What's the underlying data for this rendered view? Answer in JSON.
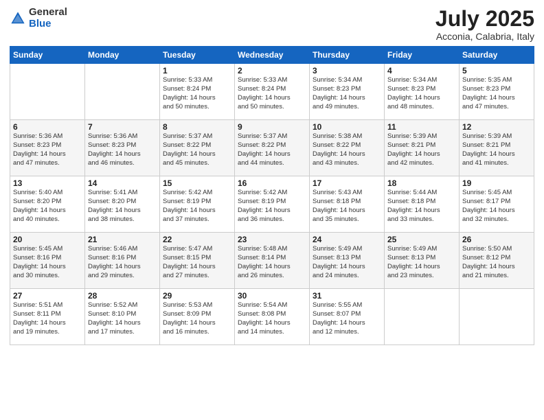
{
  "logo": {
    "general": "General",
    "blue": "Blue"
  },
  "header": {
    "month": "July 2025",
    "location": "Acconia, Calabria, Italy"
  },
  "weekdays": [
    "Sunday",
    "Monday",
    "Tuesday",
    "Wednesday",
    "Thursday",
    "Friday",
    "Saturday"
  ],
  "weeks": [
    [
      {
        "day": "",
        "info": ""
      },
      {
        "day": "",
        "info": ""
      },
      {
        "day": "1",
        "info": "Sunrise: 5:33 AM\nSunset: 8:24 PM\nDaylight: 14 hours\nand 50 minutes."
      },
      {
        "day": "2",
        "info": "Sunrise: 5:33 AM\nSunset: 8:24 PM\nDaylight: 14 hours\nand 50 minutes."
      },
      {
        "day": "3",
        "info": "Sunrise: 5:34 AM\nSunset: 8:23 PM\nDaylight: 14 hours\nand 49 minutes."
      },
      {
        "day": "4",
        "info": "Sunrise: 5:34 AM\nSunset: 8:23 PM\nDaylight: 14 hours\nand 48 minutes."
      },
      {
        "day": "5",
        "info": "Sunrise: 5:35 AM\nSunset: 8:23 PM\nDaylight: 14 hours\nand 47 minutes."
      }
    ],
    [
      {
        "day": "6",
        "info": "Sunrise: 5:36 AM\nSunset: 8:23 PM\nDaylight: 14 hours\nand 47 minutes."
      },
      {
        "day": "7",
        "info": "Sunrise: 5:36 AM\nSunset: 8:23 PM\nDaylight: 14 hours\nand 46 minutes."
      },
      {
        "day": "8",
        "info": "Sunrise: 5:37 AM\nSunset: 8:22 PM\nDaylight: 14 hours\nand 45 minutes."
      },
      {
        "day": "9",
        "info": "Sunrise: 5:37 AM\nSunset: 8:22 PM\nDaylight: 14 hours\nand 44 minutes."
      },
      {
        "day": "10",
        "info": "Sunrise: 5:38 AM\nSunset: 8:22 PM\nDaylight: 14 hours\nand 43 minutes."
      },
      {
        "day": "11",
        "info": "Sunrise: 5:39 AM\nSunset: 8:21 PM\nDaylight: 14 hours\nand 42 minutes."
      },
      {
        "day": "12",
        "info": "Sunrise: 5:39 AM\nSunset: 8:21 PM\nDaylight: 14 hours\nand 41 minutes."
      }
    ],
    [
      {
        "day": "13",
        "info": "Sunrise: 5:40 AM\nSunset: 8:20 PM\nDaylight: 14 hours\nand 40 minutes."
      },
      {
        "day": "14",
        "info": "Sunrise: 5:41 AM\nSunset: 8:20 PM\nDaylight: 14 hours\nand 38 minutes."
      },
      {
        "day": "15",
        "info": "Sunrise: 5:42 AM\nSunset: 8:19 PM\nDaylight: 14 hours\nand 37 minutes."
      },
      {
        "day": "16",
        "info": "Sunrise: 5:42 AM\nSunset: 8:19 PM\nDaylight: 14 hours\nand 36 minutes."
      },
      {
        "day": "17",
        "info": "Sunrise: 5:43 AM\nSunset: 8:18 PM\nDaylight: 14 hours\nand 35 minutes."
      },
      {
        "day": "18",
        "info": "Sunrise: 5:44 AM\nSunset: 8:18 PM\nDaylight: 14 hours\nand 33 minutes."
      },
      {
        "day": "19",
        "info": "Sunrise: 5:45 AM\nSunset: 8:17 PM\nDaylight: 14 hours\nand 32 minutes."
      }
    ],
    [
      {
        "day": "20",
        "info": "Sunrise: 5:45 AM\nSunset: 8:16 PM\nDaylight: 14 hours\nand 30 minutes."
      },
      {
        "day": "21",
        "info": "Sunrise: 5:46 AM\nSunset: 8:16 PM\nDaylight: 14 hours\nand 29 minutes."
      },
      {
        "day": "22",
        "info": "Sunrise: 5:47 AM\nSunset: 8:15 PM\nDaylight: 14 hours\nand 27 minutes."
      },
      {
        "day": "23",
        "info": "Sunrise: 5:48 AM\nSunset: 8:14 PM\nDaylight: 14 hours\nand 26 minutes."
      },
      {
        "day": "24",
        "info": "Sunrise: 5:49 AM\nSunset: 8:13 PM\nDaylight: 14 hours\nand 24 minutes."
      },
      {
        "day": "25",
        "info": "Sunrise: 5:49 AM\nSunset: 8:13 PM\nDaylight: 14 hours\nand 23 minutes."
      },
      {
        "day": "26",
        "info": "Sunrise: 5:50 AM\nSunset: 8:12 PM\nDaylight: 14 hours\nand 21 minutes."
      }
    ],
    [
      {
        "day": "27",
        "info": "Sunrise: 5:51 AM\nSunset: 8:11 PM\nDaylight: 14 hours\nand 19 minutes."
      },
      {
        "day": "28",
        "info": "Sunrise: 5:52 AM\nSunset: 8:10 PM\nDaylight: 14 hours\nand 17 minutes."
      },
      {
        "day": "29",
        "info": "Sunrise: 5:53 AM\nSunset: 8:09 PM\nDaylight: 14 hours\nand 16 minutes."
      },
      {
        "day": "30",
        "info": "Sunrise: 5:54 AM\nSunset: 8:08 PM\nDaylight: 14 hours\nand 14 minutes."
      },
      {
        "day": "31",
        "info": "Sunrise: 5:55 AM\nSunset: 8:07 PM\nDaylight: 14 hours\nand 12 minutes."
      },
      {
        "day": "",
        "info": ""
      },
      {
        "day": "",
        "info": ""
      }
    ]
  ]
}
